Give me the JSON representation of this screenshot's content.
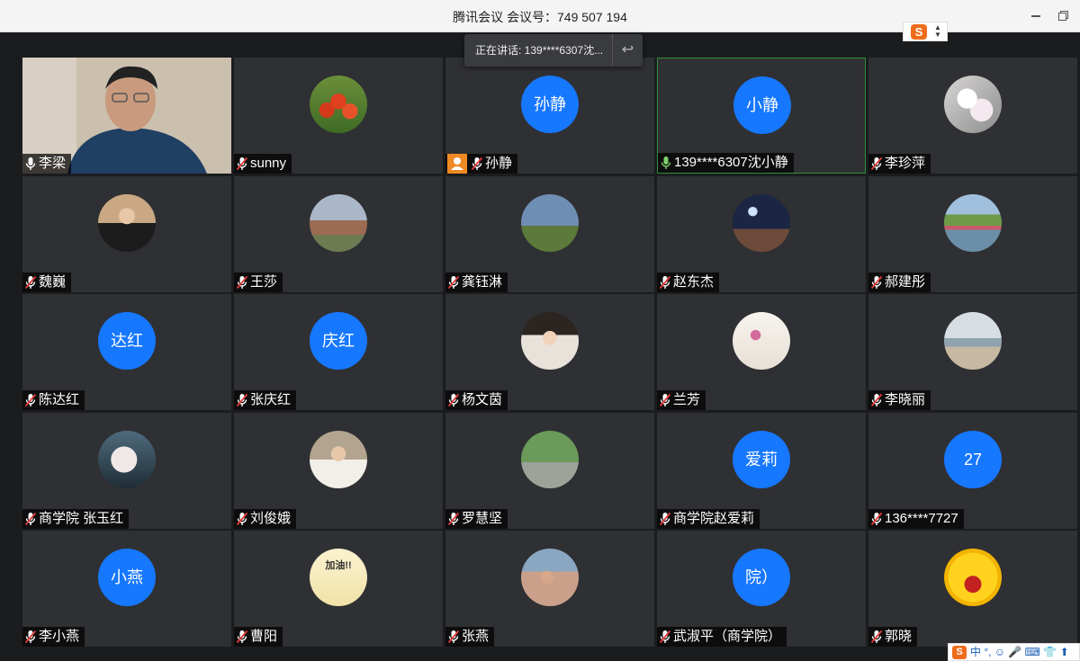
{
  "window": {
    "title": "腾讯会议 会议号：749 507 194"
  },
  "speaking_tip": {
    "text": "正在讲话: 139****6307沈..."
  },
  "ime_bottom": {
    "logo": "S",
    "text": "中 °, ☺ 🎤 ⌨ 👕 ⬆"
  },
  "participants": [
    {
      "name": "李梁",
      "mic": "on",
      "avatar_type": "video"
    },
    {
      "name": "sunny",
      "mic": "muted",
      "avatar_type": "photo",
      "photo": "tulips"
    },
    {
      "name": "孙静",
      "mic": "muted",
      "avatar_type": "text",
      "avatar_text": "孙静",
      "host": true
    },
    {
      "name": "139****6307沈小静",
      "mic": "speaking",
      "avatar_type": "text",
      "avatar_text": "小静",
      "active": true
    },
    {
      "name": "李珍萍",
      "mic": "muted",
      "avatar_type": "photo",
      "photo": "blossom"
    },
    {
      "name": "魏巍",
      "mic": "muted",
      "avatar_type": "photo",
      "photo": "portrait-woman"
    },
    {
      "name": "王莎",
      "mic": "muted",
      "avatar_type": "photo",
      "photo": "building"
    },
    {
      "name": "龚钰淋",
      "mic": "muted",
      "avatar_type": "photo",
      "photo": "lighthouse"
    },
    {
      "name": "赵东杰",
      "mic": "muted",
      "avatar_type": "photo",
      "photo": "night-city"
    },
    {
      "name": "郝建彤",
      "mic": "muted",
      "avatar_type": "photo",
      "photo": "lake"
    },
    {
      "name": "陈达红",
      "mic": "muted",
      "avatar_type": "text",
      "avatar_text": "达红"
    },
    {
      "name": "张庆红",
      "mic": "muted",
      "avatar_type": "text",
      "avatar_text": "庆红"
    },
    {
      "name": "杨文茵",
      "mic": "muted",
      "avatar_type": "photo",
      "photo": "girl"
    },
    {
      "name": "兰芳",
      "mic": "muted",
      "avatar_type": "photo",
      "photo": "calligraphy"
    },
    {
      "name": "李晓丽",
      "mic": "muted",
      "avatar_type": "photo",
      "photo": "beach"
    },
    {
      "name": "商学院 张玉红",
      "mic": "muted",
      "avatar_type": "photo",
      "photo": "profile"
    },
    {
      "name": "刘俊娥",
      "mic": "muted",
      "avatar_type": "photo",
      "photo": "baby"
    },
    {
      "name": "罗慧坚",
      "mic": "muted",
      "avatar_type": "photo",
      "photo": "park"
    },
    {
      "name": "商学院赵爱莉",
      "mic": "muted",
      "avatar_type": "text",
      "avatar_text": "爱莉"
    },
    {
      "name": "136****7727",
      "mic": "muted",
      "avatar_type": "text",
      "avatar_text": "27"
    },
    {
      "name": "李小燕",
      "mic": "muted",
      "avatar_type": "text",
      "avatar_text": "小燕"
    },
    {
      "name": "曹阳",
      "mic": "muted",
      "avatar_type": "photo",
      "photo": "cartoon-jiayou",
      "photo_text": "加油!!"
    },
    {
      "name": "张燕",
      "mic": "muted",
      "avatar_type": "photo",
      "photo": "kids"
    },
    {
      "name": "武淑平（商学院）",
      "mic": "muted",
      "avatar_type": "text",
      "avatar_text": "院）"
    },
    {
      "name": "郭晓",
      "mic": "muted",
      "avatar_type": "photo",
      "photo": "emoji-laugh"
    }
  ],
  "colors": {
    "avatar_blue": "#1677ff",
    "tile_bg": "#2f3033",
    "speaking_green": "#2f8f3a",
    "host_orange": "#f08a24"
  }
}
